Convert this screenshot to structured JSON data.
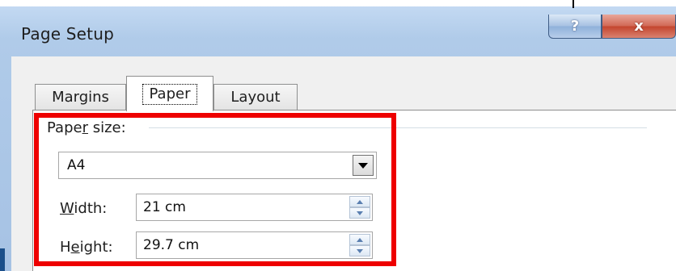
{
  "window": {
    "title": "Page Setup",
    "help_label": "?",
    "close_label": "x"
  },
  "tabs": [
    {
      "label": "Margins",
      "selected": false
    },
    {
      "label": "Paper",
      "selected": true
    },
    {
      "label": "Layout",
      "selected": false
    }
  ],
  "paper_size": {
    "group_label_pre": "Pape",
    "group_label_key": "r",
    "group_label_post": " size:",
    "selected": "A4"
  },
  "width": {
    "label_key": "W",
    "label_rest": "idth:",
    "value": "21 cm"
  },
  "height": {
    "label_pre": "H",
    "label_key": "e",
    "label_post": "ight:",
    "value": "29.7 cm"
  },
  "colors": {
    "highlight": "#ee0000",
    "title_bar": "#b0cbe9",
    "close_button": "#c4452e"
  }
}
